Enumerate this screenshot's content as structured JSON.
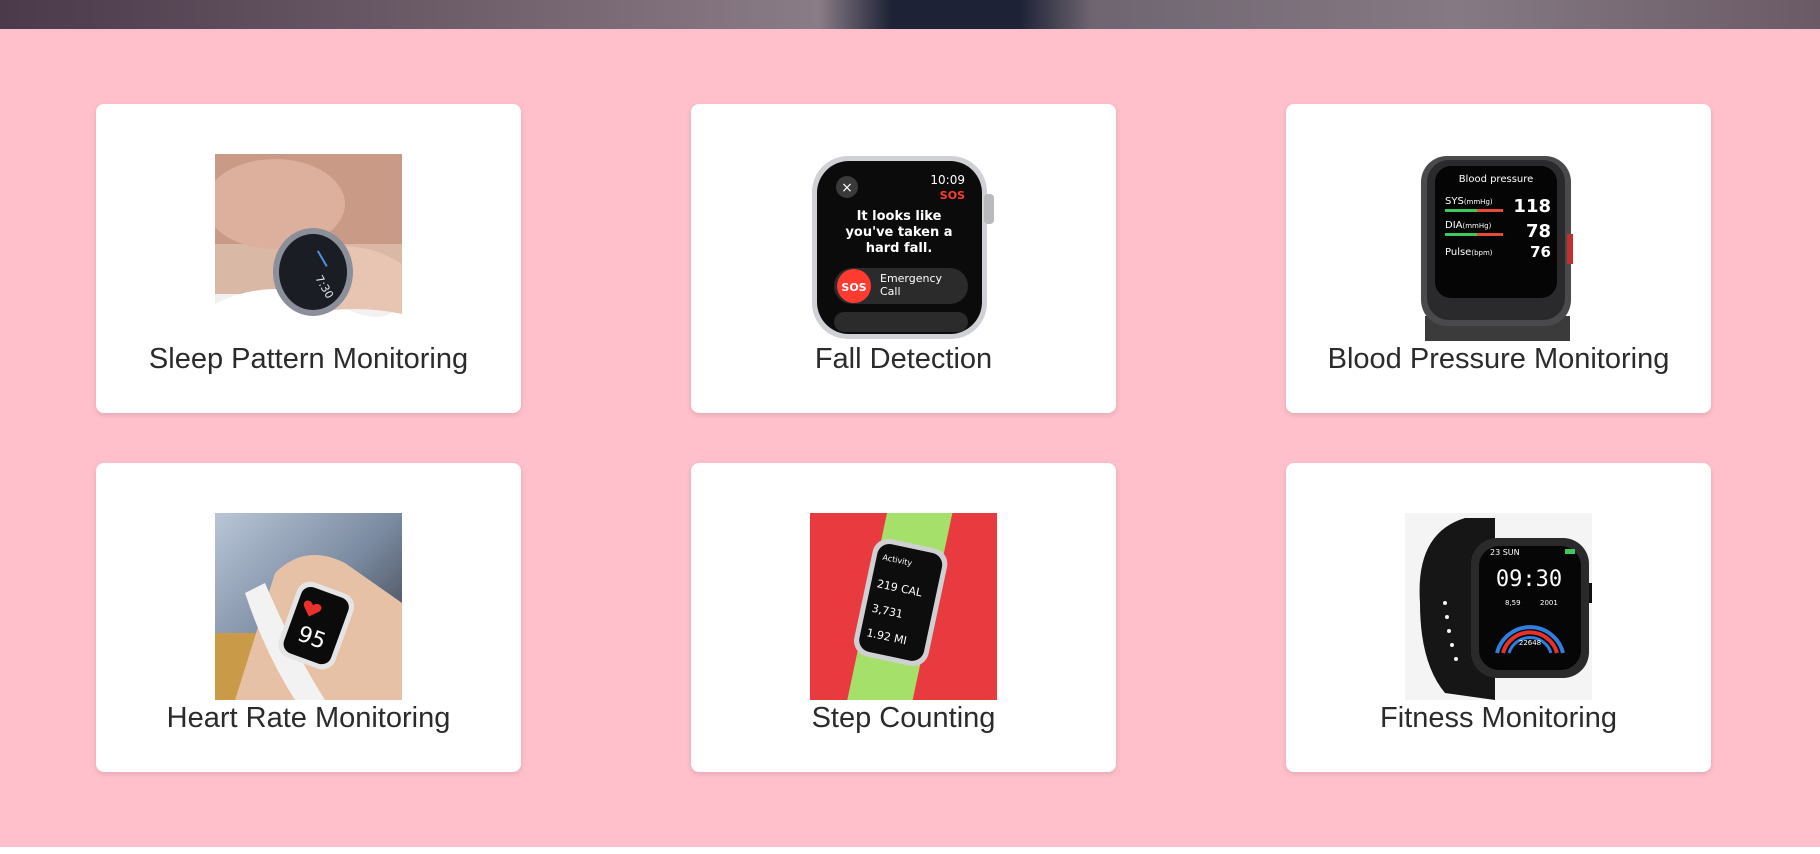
{
  "features": [
    {
      "label": "Sleep Pattern Monitoring",
      "icon": "sleep-watch-image"
    },
    {
      "label": "Fall Detection",
      "icon": "fall-detection-watch-image",
      "screen": {
        "time": "10:09",
        "badge": "SOS",
        "message_line1": "It looks like",
        "message_line2": "you've taken a",
        "message_line3": "hard fall.",
        "action_button": "SOS",
        "action_line1": "Emergency",
        "action_line2": "Call"
      }
    },
    {
      "label": "Blood Pressure Monitoring",
      "icon": "blood-pressure-watch-image",
      "screen": {
        "title": "Blood pressure",
        "sys_label": "SYS",
        "sys_unit": "(mmHg)",
        "sys_value": "118",
        "dia_label": "DIA",
        "dia_unit": "(mmHg)",
        "dia_value": "78",
        "pulse_label": "Pulse",
        "pulse_unit": "(bpm)",
        "pulse_value": "76"
      }
    },
    {
      "label": "Heart Rate Monitoring",
      "icon": "heart-rate-watch-image",
      "screen": {
        "value": "95"
      }
    },
    {
      "label": "Step Counting",
      "icon": "step-counting-watch-image",
      "screen": {
        "title": "Activity",
        "cal": "219 CAL",
        "steps": "3,731",
        "distance": "1.92 MI"
      }
    },
    {
      "label": "Fitness Monitoring",
      "icon": "fitness-watch-image",
      "screen": {
        "date": "23 SUN",
        "time": "09:30",
        "stat_left": "8,59",
        "stat_right": "2001",
        "stat_bottom": "22648"
      }
    }
  ],
  "colors": {
    "section_bg": "#ffc0cb",
    "card_bg": "#ffffff",
    "label_text": "#2b2b2b"
  }
}
